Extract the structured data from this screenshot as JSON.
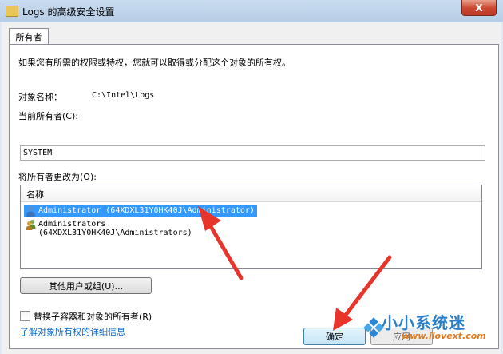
{
  "window": {
    "title": "Logs 的高级安全设置",
    "close_glyph": "X"
  },
  "tabs": [
    {
      "label": "所有者"
    }
  ],
  "owner_tab": {
    "intro": "如果您有所需的权限或特权，您就可以取得或分配这个对象的所有权。",
    "object_name_label": "对象名称：",
    "object_name_value": "C:\\Intel\\Logs",
    "current_owner_label": "当前所有者(C):",
    "current_owner_value": "SYSTEM",
    "change_owner_label": "将所有者更改为(O):",
    "list_header": "名称",
    "list_items": [
      {
        "label": "Administrator (64XDXL31Y0HK40J\\Administrator)",
        "selected": true,
        "icon": "user-icon"
      },
      {
        "label": "Administrators (64XDXL31Y0HK40J\\Administrators)",
        "selected": false,
        "icon": "users-group-icon"
      }
    ],
    "other_users_button": "其他用户或组(U)...",
    "replace_checkbox_label": "替换子容器和对象的所有者(R)",
    "replace_checked": false,
    "learn_more_link": "了解对象所有权的详细信息"
  },
  "footer": {
    "ok_button": "确定",
    "apply_button": "应用"
  },
  "watermark": {
    "brand": "小小系统迷",
    "url": "www.ilovext.com"
  },
  "colors": {
    "selection": "#3399ff",
    "link": "#0066cc",
    "annotation_arrow": "#e8352b"
  }
}
